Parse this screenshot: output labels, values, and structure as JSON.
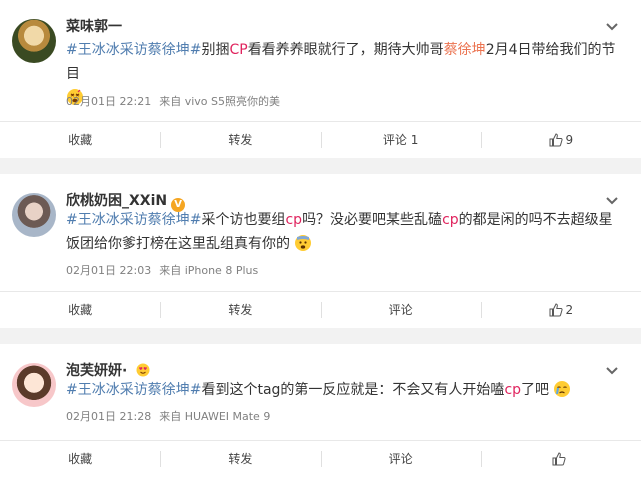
{
  "comments": [
    {
      "user": "菜味郭一",
      "content_parts": [
        "#王冰冰采访蔡徐坤#",
        "别",
        "捆",
        "CP",
        "看看养养眼就行了，期待大帅哥",
        "蔡徐坤",
        "2月4日带给我们的节目"
      ],
      "emoji": "dizzy-face-emoji",
      "time": "02月01日 22:21",
      "source": "来自 vivo S5照亮你的美",
      "actions": {
        "favorite": "收藏",
        "repost": "转发",
        "comment": "评论 1",
        "like_count": "9"
      }
    },
    {
      "user": "欣桃奶困_XXiN",
      "badge": "V",
      "content_parts": [
        "#王冰冰采访蔡徐坤#",
        "采个访也要组",
        "cp",
        "吗？没必要吧某些乱磕",
        "cp",
        "的都是闲的吗不去超级星饭团给你爹打榜在这里乱组真有你的"
      ],
      "emoji": "fearful-face-emoji",
      "time": "02月01日 22:03",
      "source": "来自 iPhone 8 Plus",
      "actions": {
        "favorite": "收藏",
        "repost": "转发",
        "comment": "评论",
        "like_count": "2"
      }
    },
    {
      "user": "泡芙妍妍·",
      "badge": "heart-eyes-emoji",
      "content_parts": [
        "#王冰冰采访蔡徐坤#",
        "看到这个tag的第一反应就是：不会又有人开始嗑",
        "cp",
        "了吧"
      ],
      "emoji": "crying-face-emoji",
      "time": "02月01日 21:28",
      "source": "来自 HUAWEI Mate 9",
      "actions": {
        "favorite": "收藏",
        "repost": "转发",
        "comment": "评论",
        "like_count": ""
      }
    }
  ],
  "icons": {
    "more": "chevron-down-icon",
    "like": "thumbs-up-icon"
  },
  "colors": {
    "hashtag": "#507daf",
    "topic": "#eb7350",
    "cp": "#e0245e",
    "meta": "#808080",
    "background": "#f2f2f2"
  }
}
